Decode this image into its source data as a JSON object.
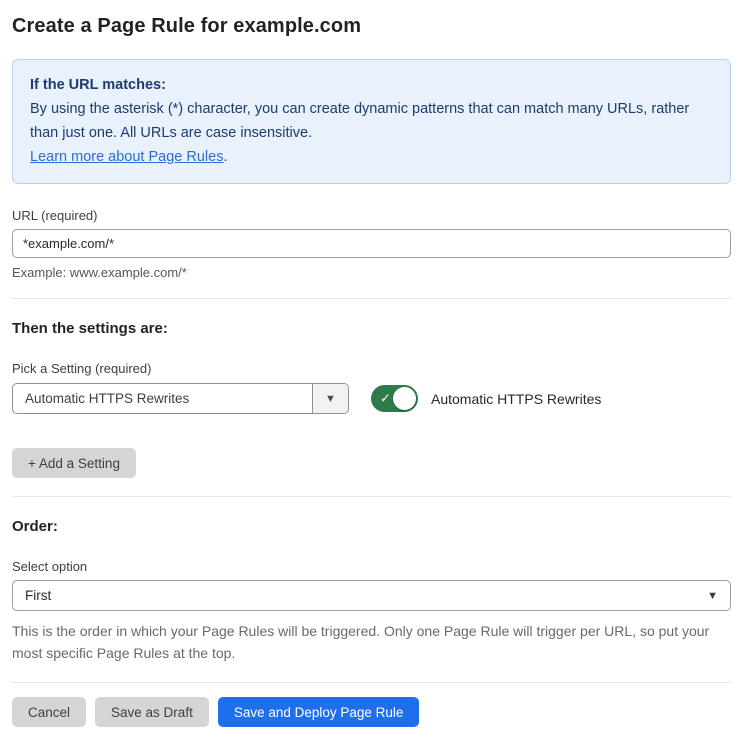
{
  "page": {
    "title": "Create a Page Rule for example.com"
  },
  "info_box": {
    "heading": "If the URL matches:",
    "body": "By using the asterisk (*) character, you can create dynamic patterns that can match many URLs, rather than just one. All URLs are case insensitive.",
    "link_label": "Learn more about Page Rules",
    "link_suffix": "."
  },
  "url_field": {
    "label": "URL (required)",
    "value": "*example.com/*",
    "helper": "Example: www.example.com/*"
  },
  "settings_section": {
    "heading": "Then the settings are:",
    "picker_label": "Pick a Setting (required)",
    "picker_value": "Automatic HTTPS Rewrites",
    "toggle_state": "on",
    "toggle_label": "Automatic HTTPS Rewrites",
    "add_setting_label": "+ Add a Setting"
  },
  "order_section": {
    "heading": "Order:",
    "select_label": "Select option",
    "select_value": "First",
    "helper": "This is the order in which your Page Rules will be triggered. Only one Page Rule will trigger per URL, so put your most specific Page Rules at the top."
  },
  "footer": {
    "cancel_label": "Cancel",
    "save_draft_label": "Save as Draft",
    "save_deploy_label": "Save and Deploy Page Rule"
  },
  "icons": {
    "caret_down": "▼",
    "check": "✓"
  },
  "colors": {
    "info_bg": "#e8f1fc",
    "info_border": "#b9d4f1",
    "info_text": "#1d3c6e",
    "link_blue": "#2b6cd9",
    "toggle_green": "#2e7b4a",
    "primary_blue": "#1f6fed",
    "button_gray": "#d5d5d5"
  }
}
